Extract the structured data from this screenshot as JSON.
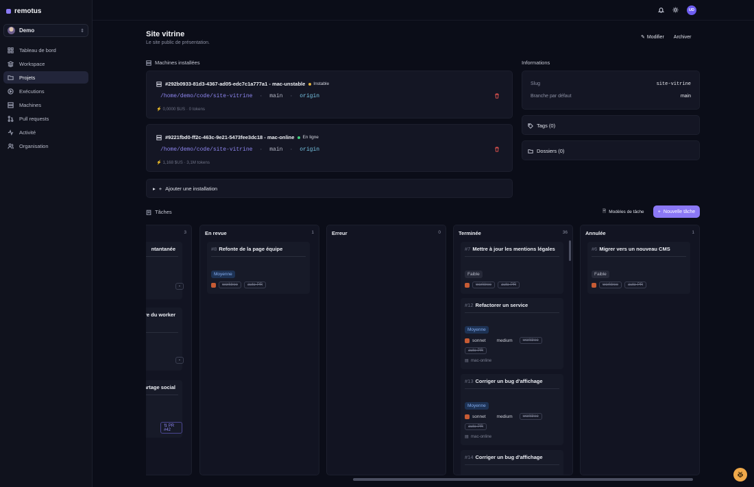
{
  "app": {
    "brand": "remotus",
    "workspace": "Demo"
  },
  "nav": [
    {
      "label": "Tableau de bord",
      "icon": "grid-icon"
    },
    {
      "label": "Workspace",
      "icon": "layers-icon"
    },
    {
      "label": "Projets",
      "icon": "folder-icon",
      "active": true
    },
    {
      "label": "Exécutions",
      "icon": "play-circle-icon"
    },
    {
      "label": "Machines",
      "icon": "server-icon"
    },
    {
      "label": "Pull requests",
      "icon": "git-pull-request-icon"
    },
    {
      "label": "Activité",
      "icon": "activity-icon"
    },
    {
      "label": "Organisation",
      "icon": "users-icon"
    }
  ],
  "topbar": {
    "user_initials": "UD"
  },
  "project": {
    "title": "Site vitrine",
    "subtitle": "Le site public de présentation.",
    "edit_label": "Modifier",
    "archive_label": "Archiver"
  },
  "installations": {
    "section_label": "Machines installées",
    "items": [
      {
        "name": "#292b0933-81d3-4367-ad05-edc7c1a777a1 - mac-unstable",
        "status": "Instable",
        "status_color": "#e5b53f",
        "path": "/home/demo/code/site-vitrine",
        "branch": "main",
        "remote": "origin",
        "cost": "0,0000 $US",
        "tokens": "0 tokens"
      },
      {
        "name": "#9221fbd0-ff2c-463c-9e21-5473fee3dc18 - mac-online",
        "status": "En ligne",
        "status_color": "#3fd07e",
        "path": "/home/demo/code/site-vitrine",
        "branch": "main",
        "remote": "origin",
        "cost": "1,168 $US",
        "tokens": "3,1M tokens"
      }
    ],
    "add_label": "Ajouter une installation"
  },
  "info": {
    "section_label": "Informations",
    "slug_label": "Slug",
    "slug_value": "site-vitrine",
    "branch_label": "Branche par défaut",
    "branch_value": "main",
    "tags_label": "Tags (0)",
    "folders_label": "Dossiers (0)"
  },
  "tasks": {
    "section_label": "Tâches",
    "templates_label": "Modèles de tâche",
    "new_label": "Nouvelle tâche",
    "columns": [
      {
        "name": "",
        "count": "3",
        "cards": [
          {
            "title": "ntantanée"
          },
          {
            "title": "noire du worker"
          },
          {
            "title": "artage social",
            "pr": "PR #42"
          }
        ]
      },
      {
        "name": "En revue",
        "count": "1",
        "cards": [
          {
            "num": "#8",
            "title": "Refonte de la page équipe",
            "priority": "Moyenne"
          }
        ]
      },
      {
        "name": "Erreur",
        "count": "0",
        "cards": []
      },
      {
        "name": "Terminée",
        "count": "36",
        "cards": [
          {
            "num": "#7",
            "title": "Mettre à jour les mentions légales",
            "priority": "Faible"
          },
          {
            "num": "#12",
            "title": "Refactorer un service",
            "priority": "Moyenne",
            "model": "sonnet",
            "effort": "medium",
            "machine": "mac-online"
          },
          {
            "num": "#13",
            "title": "Corriger un bug d'affichage",
            "priority": "Moyenne",
            "model": "sonnet",
            "effort": "medium",
            "machine": "mac-online"
          },
          {
            "num": "#14",
            "title": "Corriger un bug d'affichage"
          }
        ]
      },
      {
        "name": "Annulée",
        "count": "1",
        "cards": [
          {
            "num": "#6",
            "title": "Migrer vers un nouveau CMS",
            "priority": "Faible"
          }
        ]
      }
    ],
    "chip_worktree": "worktree",
    "chip_autopr": "auto-PR"
  }
}
